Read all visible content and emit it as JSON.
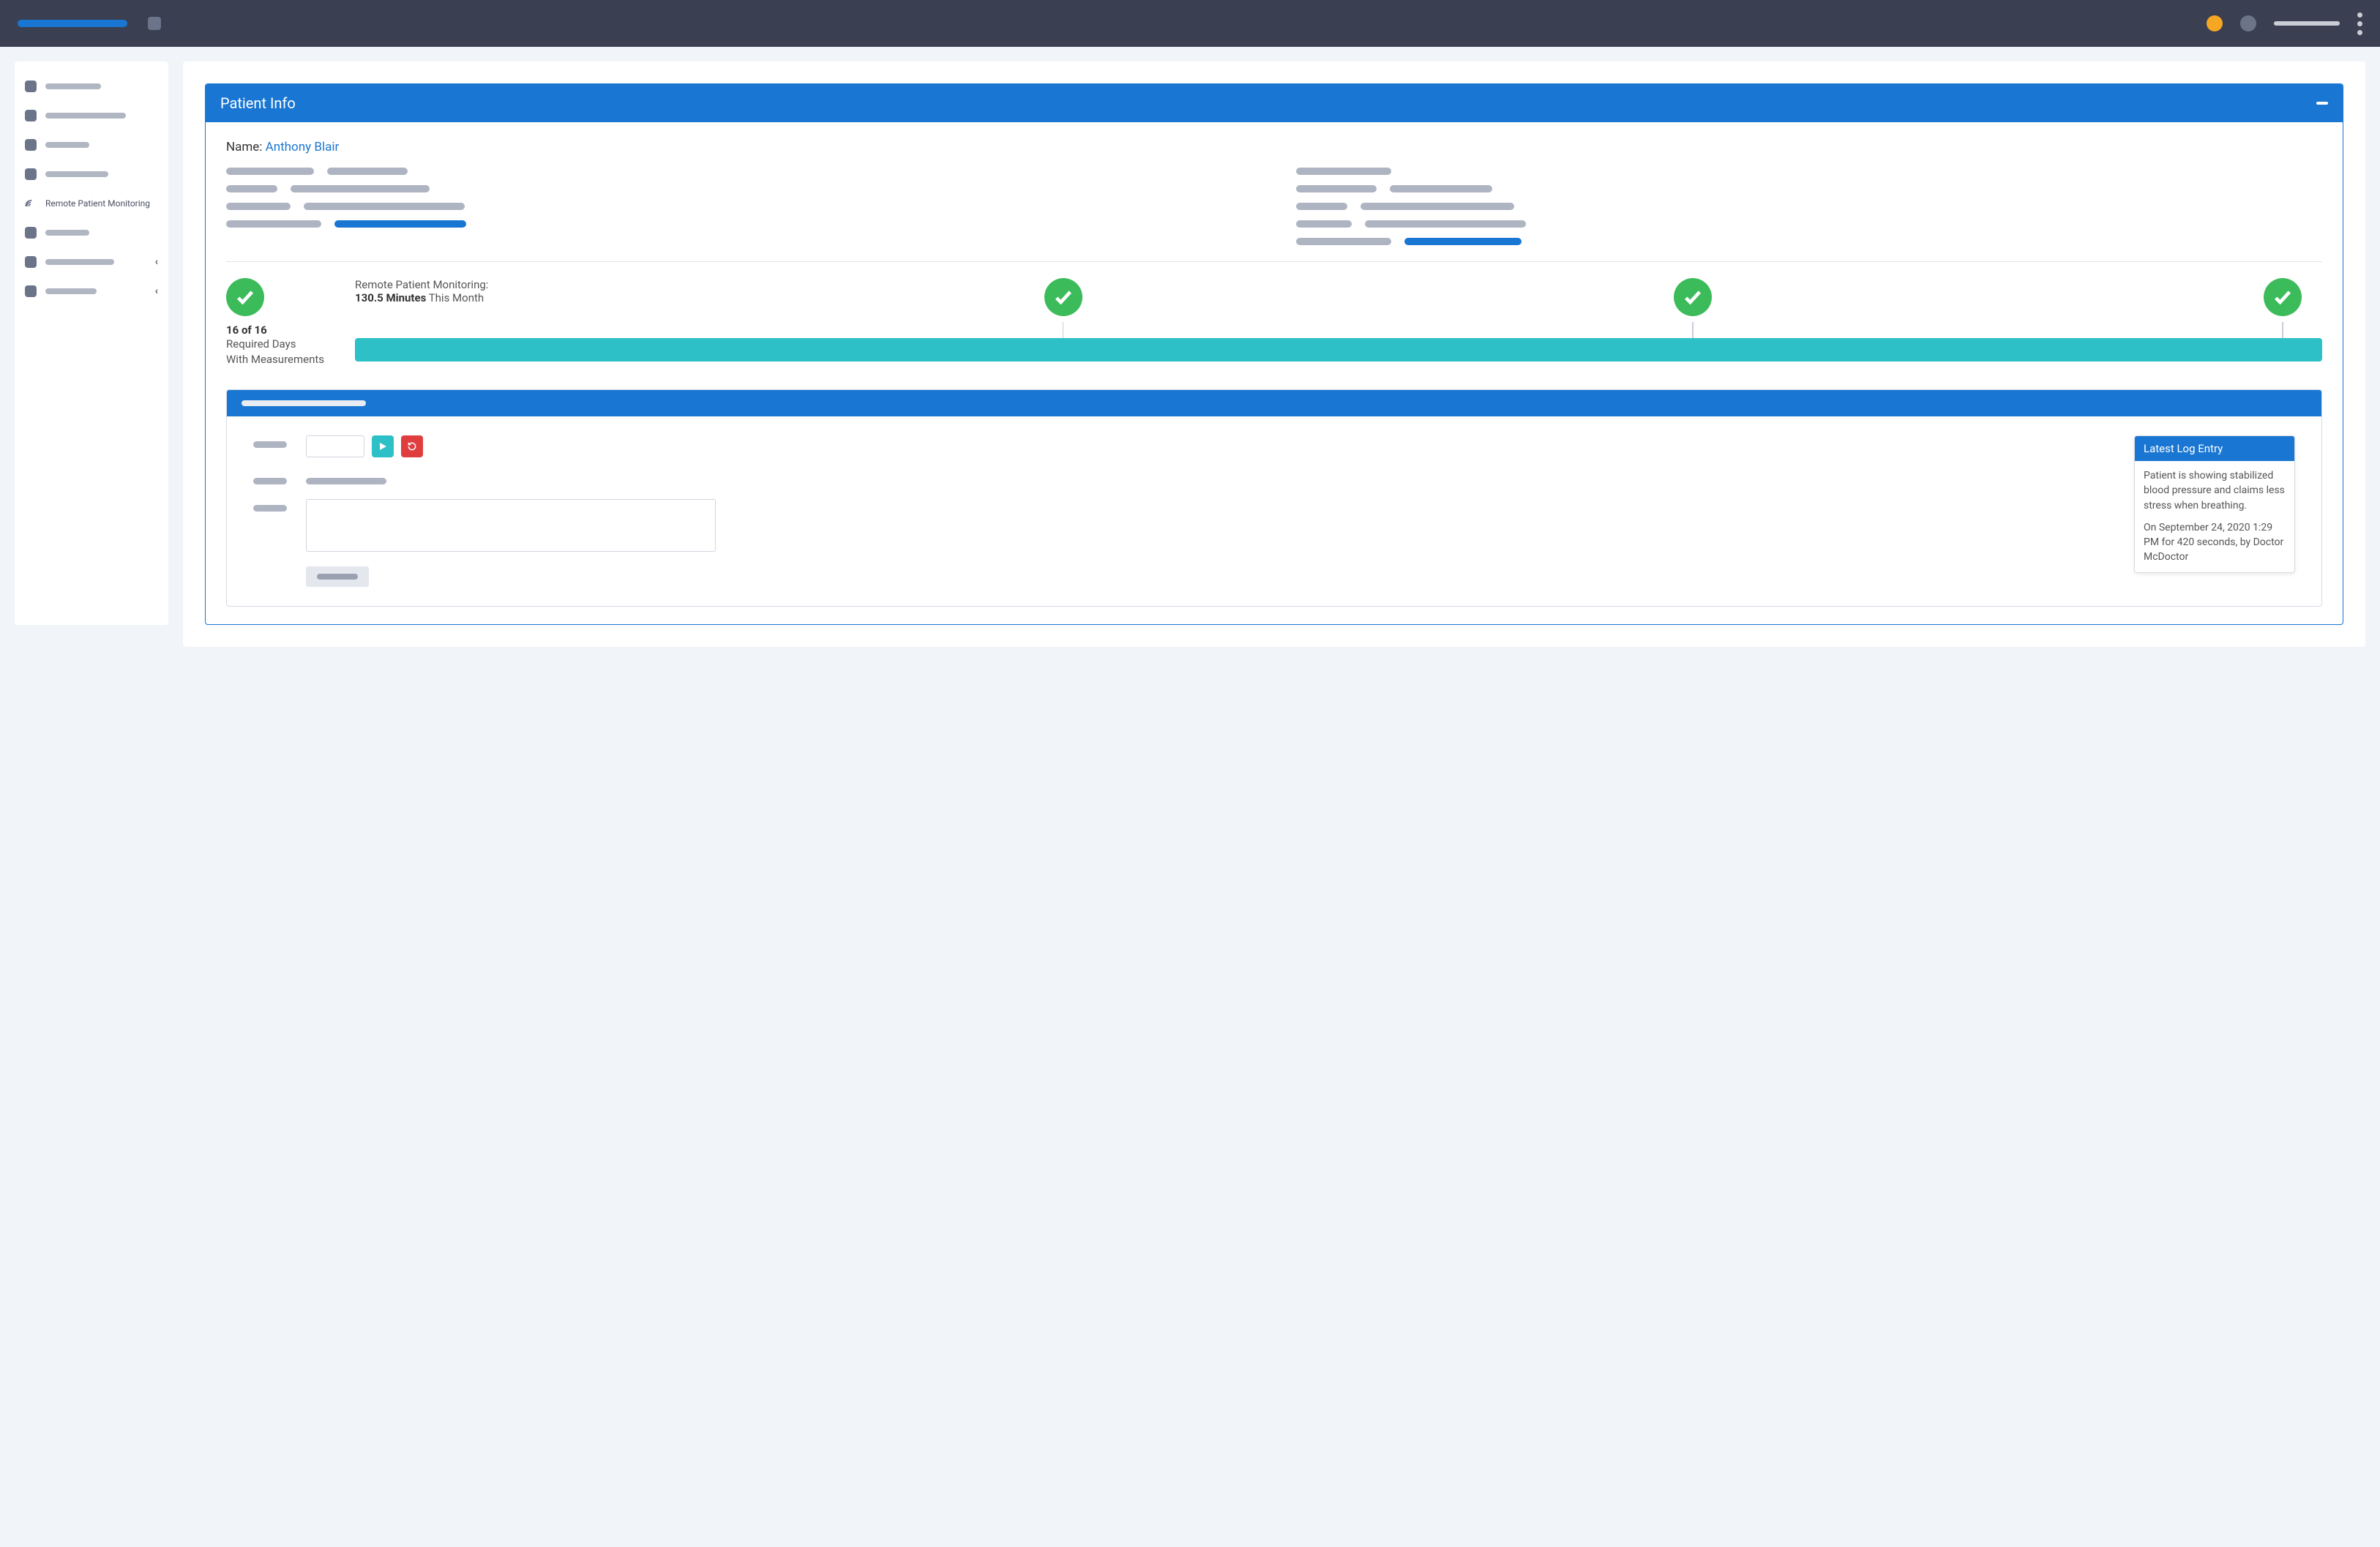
{
  "sidebar": {
    "items": [
      {
        "label": ""
      },
      {
        "label": ""
      },
      {
        "label": ""
      },
      {
        "label": ""
      },
      {
        "label": "Remote Patient Monitoring"
      },
      {
        "label": ""
      },
      {
        "label": ""
      },
      {
        "label": ""
      }
    ]
  },
  "panel": {
    "title": "Patient Info",
    "name_label": "Name: ",
    "name_value": "Anthony Blair"
  },
  "status": {
    "count": "16 of 16",
    "sub1": "Required Days",
    "sub2": "With Measurements",
    "rpm_label": "Remote Patient Monitoring:",
    "rpm_value": "130.5 Minutes",
    "rpm_suffix": " This Month"
  },
  "log": {
    "title": "Latest Log Entry",
    "text1": "Patient is showing stabilized blood pressure and claims less stress when breathing.",
    "text2": "On September 24, 2020 1:29 PM for 420 seconds, by Doctor McDoctor"
  }
}
